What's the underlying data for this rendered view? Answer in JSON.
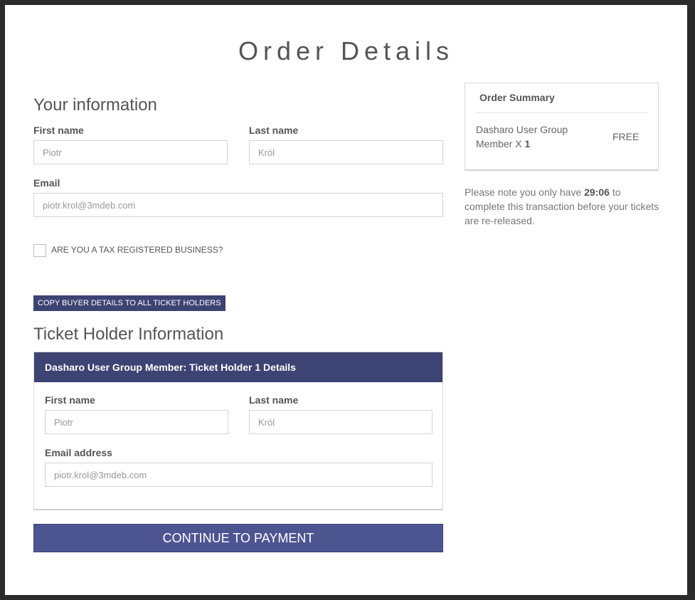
{
  "page": {
    "title": "Order Details"
  },
  "your_information": {
    "heading": "Your information",
    "first_name_label": "First name",
    "first_name_value": "Piotr",
    "last_name_label": "Last name",
    "last_name_value": "Król",
    "email_label": "Email",
    "email_value": "piotr.krol@3mdeb.com",
    "tax_checkbox_label": "ARE YOU A TAX REGISTERED BUSINESS?",
    "tax_checkbox_checked": false,
    "copy_button_label": "COPY BUYER DETAILS TO ALL TICKET HOLDERS"
  },
  "ticket_holders": {
    "heading": "Ticket Holder Information",
    "holders": [
      {
        "header": "Dasharo User Group Member: Ticket Holder 1 Details",
        "first_name_label": "First name",
        "first_name_value": "Piotr",
        "last_name_label": "Last name",
        "last_name_value": "Król",
        "email_label": "Email address",
        "email_value": "piotr.krol@3mdeb.com"
      }
    ]
  },
  "actions": {
    "continue_label": "CONTINUE TO PAYMENT"
  },
  "order_summary": {
    "title": "Order Summary",
    "item_name": "Dasharo User Group Member X ",
    "item_quantity": "1",
    "item_price": "FREE"
  },
  "timer_note": {
    "prefix": "Please note you only have ",
    "time_left": "29:06",
    "suffix": " to complete this transaction before your tickets are re-released."
  },
  "colors": {
    "accent": "#3d4372",
    "button": "#4d5591",
    "background": "#2b2b2b"
  }
}
